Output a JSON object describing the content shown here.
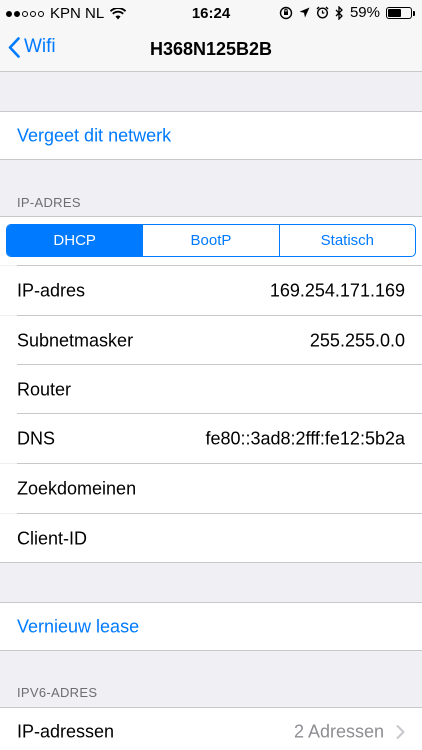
{
  "status_bar": {
    "carrier": "KPN NL",
    "time": "16:24",
    "battery": "59%",
    "battery_level": 0.59
  },
  "nav": {
    "back_label": "Wifi",
    "title": "H368N125B2B"
  },
  "forget_network": "Vergeet dit netwerk",
  "ip_section": {
    "header": "IP-ADRES",
    "segments": [
      "DHCP",
      "BootP",
      "Statisch"
    ],
    "selected": "DHCP",
    "rows": [
      {
        "label": "IP-adres",
        "value": "169.254.171.169"
      },
      {
        "label": "Subnetmasker",
        "value": "255.255.0.0"
      },
      {
        "label": "Router",
        "value": ""
      },
      {
        "label": "DNS",
        "value": "fe80::3ad8:2fff:fe12:5b2a"
      },
      {
        "label": "Zoekdomeinen",
        "value": ""
      },
      {
        "label": "Client-ID",
        "value": ""
      }
    ]
  },
  "renew_lease": "Vernieuw lease",
  "ipv6_section": {
    "header": "IPV6-ADRES",
    "row": {
      "label": "IP-adressen",
      "value": "2 Adressen"
    }
  },
  "colors": {
    "accent": "#007aff",
    "background": "#efeff4",
    "separator": "#c8c7cc"
  }
}
